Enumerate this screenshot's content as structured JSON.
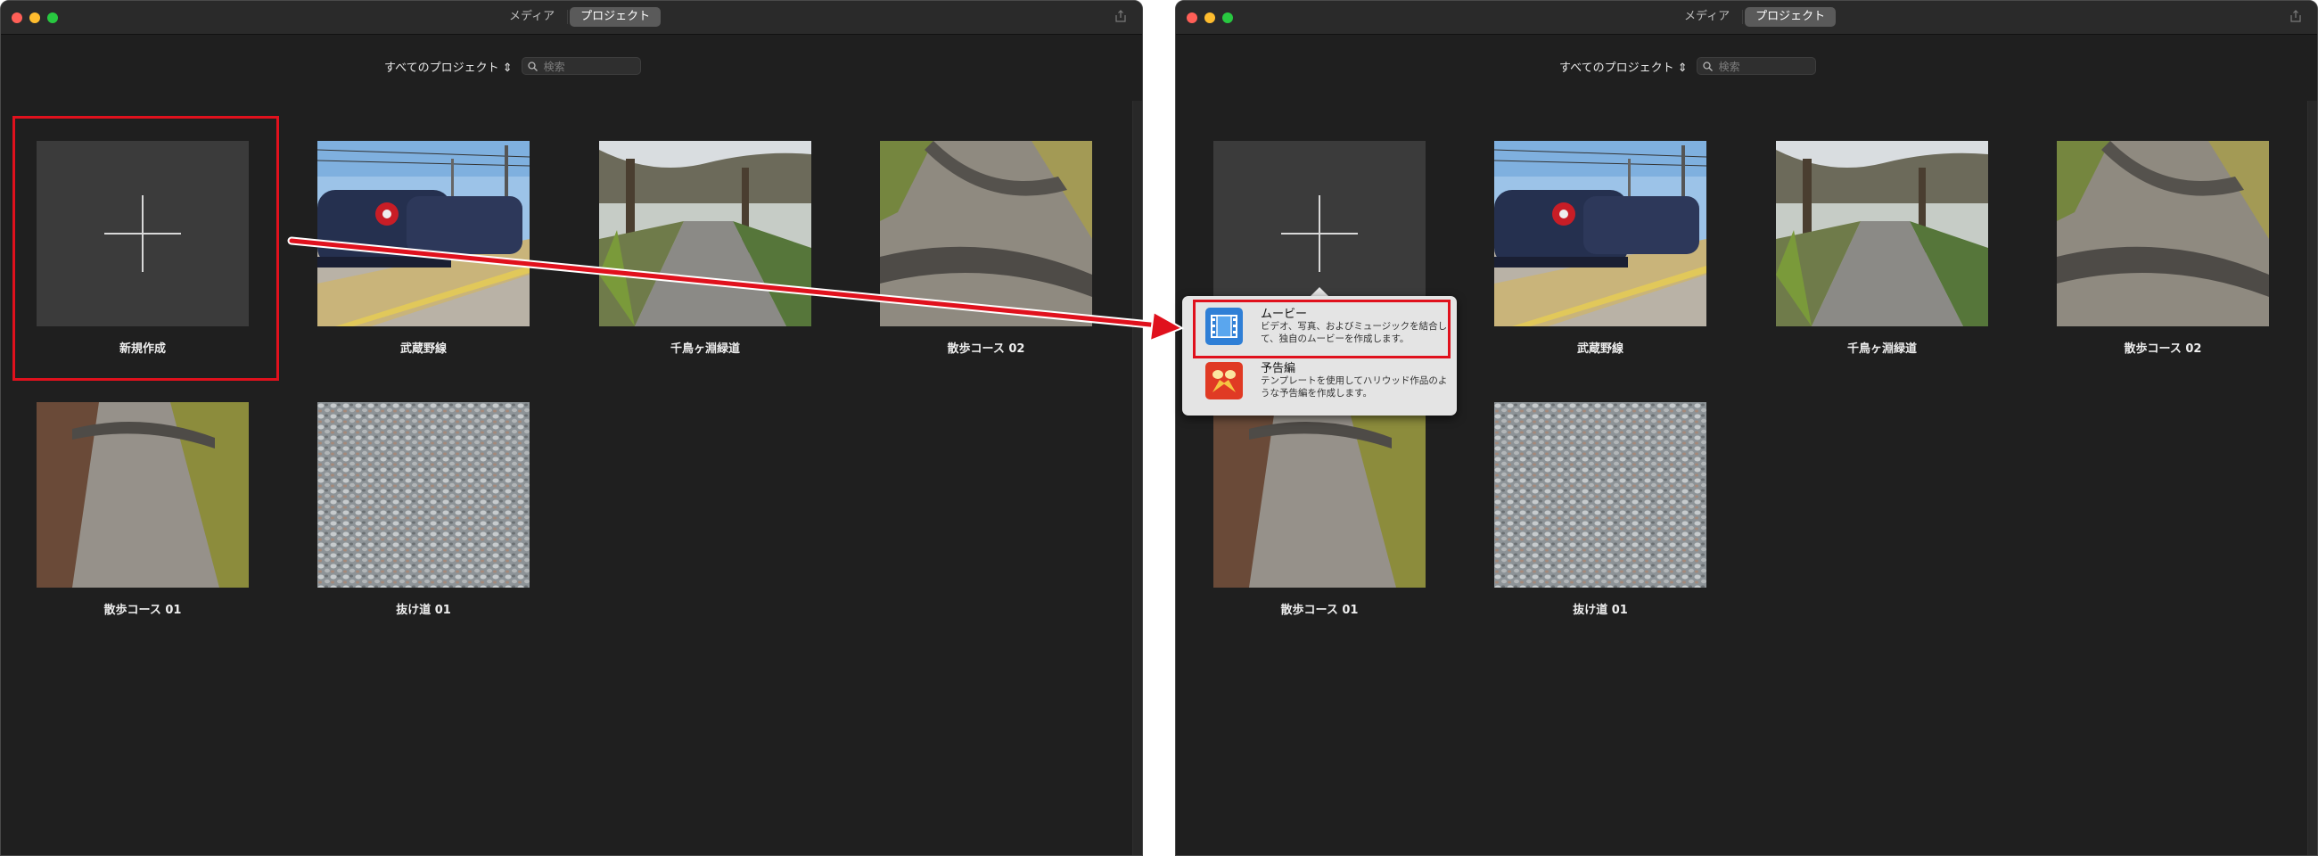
{
  "toolbar": {
    "tab_media": "メディア",
    "tab_projects": "プロジェクト"
  },
  "filter": {
    "label": "すべてのプロジェクト",
    "search_placeholder": "検索"
  },
  "projects": [
    {
      "label": "新規作成"
    },
    {
      "label": "武蔵野線"
    },
    {
      "label": "千鳥ヶ淵緑道"
    },
    {
      "label": "散歩コース 02"
    },
    {
      "label": "散歩コース 01"
    },
    {
      "label": "抜け道 01"
    }
  ],
  "popover": {
    "items": [
      {
        "title": "ムービー",
        "description": "ビデオ、写真、およびミュージックを結合して、独自のムービーを作成します。"
      },
      {
        "title": "予告編",
        "description": "テンプレートを使用してハリウッド作品のような予告編を作成します。"
      }
    ]
  },
  "colors": {
    "window_bg": "#1f1f1f",
    "highlight": "#e0111d",
    "popover_bg": "#e4e4e4"
  }
}
